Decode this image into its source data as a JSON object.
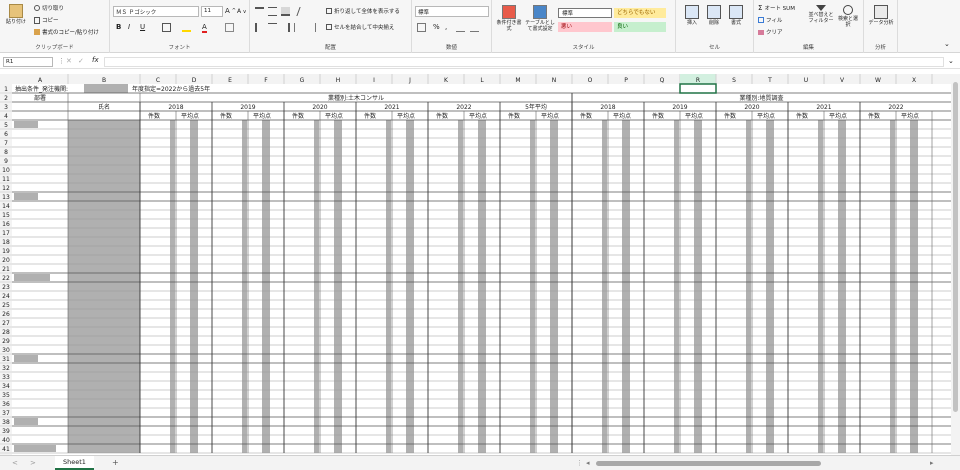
{
  "ribbon": {
    "clipboard": {
      "paste": "貼り付け",
      "cut": "切り取り",
      "copy": "コピー",
      "format_painter": "書式のコピー/貼り付け",
      "label": "クリップボード"
    },
    "font": {
      "name": "ＭＳ Ｐゴシック",
      "size": "11",
      "bold": "B",
      "italic": "I",
      "underline": "U",
      "label": "フォント"
    },
    "alignment": {
      "wrap": "折り返して全体を表示する",
      "merge": "セルを結合して中央揃え",
      "label": "配置"
    },
    "number": {
      "format": "標準",
      "label": "数値"
    },
    "styles": {
      "cond": "条件付き書式",
      "table": "テーブルとして書式設定",
      "standard": "標準",
      "neutral": "どちらでもない",
      "bad": "悪い",
      "good": "良い",
      "label": "スタイル"
    },
    "cells": {
      "insert": "挿入",
      "delete": "削除",
      "format": "書式",
      "label": "セル"
    },
    "editing": {
      "autosum": "オート SUM",
      "fill": "フィル",
      "clear": "クリア",
      "sort": "並べ替えとフィルター",
      "find": "検索と選択",
      "label": "編集"
    },
    "analysis": {
      "data": "データ分析",
      "label": "分析"
    }
  },
  "formula_bar": {
    "name_box": "R1",
    "fx": "fx",
    "value": ""
  },
  "columns": [
    "A",
    "B",
    "C",
    "D",
    "E",
    "F",
    "G",
    "H",
    "I",
    "J",
    "K",
    "L",
    "M",
    "N",
    "O",
    "P",
    "Q",
    "R",
    "S",
    "T",
    "U",
    "V",
    "W",
    "X"
  ],
  "rows": [
    "1",
    "2",
    "3",
    "4",
    "5",
    "6",
    "7",
    "8",
    "9",
    "10",
    "11",
    "12",
    "13",
    "14",
    "15",
    "16",
    "17",
    "18",
    "19",
    "20",
    "21",
    "22",
    "23",
    "24",
    "25",
    "26",
    "27",
    "28",
    "29",
    "30",
    "31",
    "32",
    "33",
    "34",
    "35",
    "36",
    "37",
    "38",
    "39",
    "40",
    "41"
  ],
  "sheet": {
    "a1": "抽出条件_発注機関:",
    "c1": "年度指定=2022から過去5年",
    "dept": "部署",
    "name": "氏名",
    "group1": "業種別:土木コンサル",
    "group2": "業種別:地質調査",
    "years1": [
      "2018",
      "2019",
      "2020",
      "2021",
      "2022",
      "5年平均"
    ],
    "years2": [
      "2018",
      "2019",
      "2020",
      "2021",
      "2022"
    ],
    "count": "件数",
    "avg": "平均点"
  },
  "tabs": {
    "sheet1": "Sheet1",
    "add": "+"
  },
  "colors": {
    "grey": "#b0b0b0",
    "styles_bad": "#ffc7ce",
    "styles_good": "#c6efce",
    "styles_neutral": "#ffeb9c"
  }
}
